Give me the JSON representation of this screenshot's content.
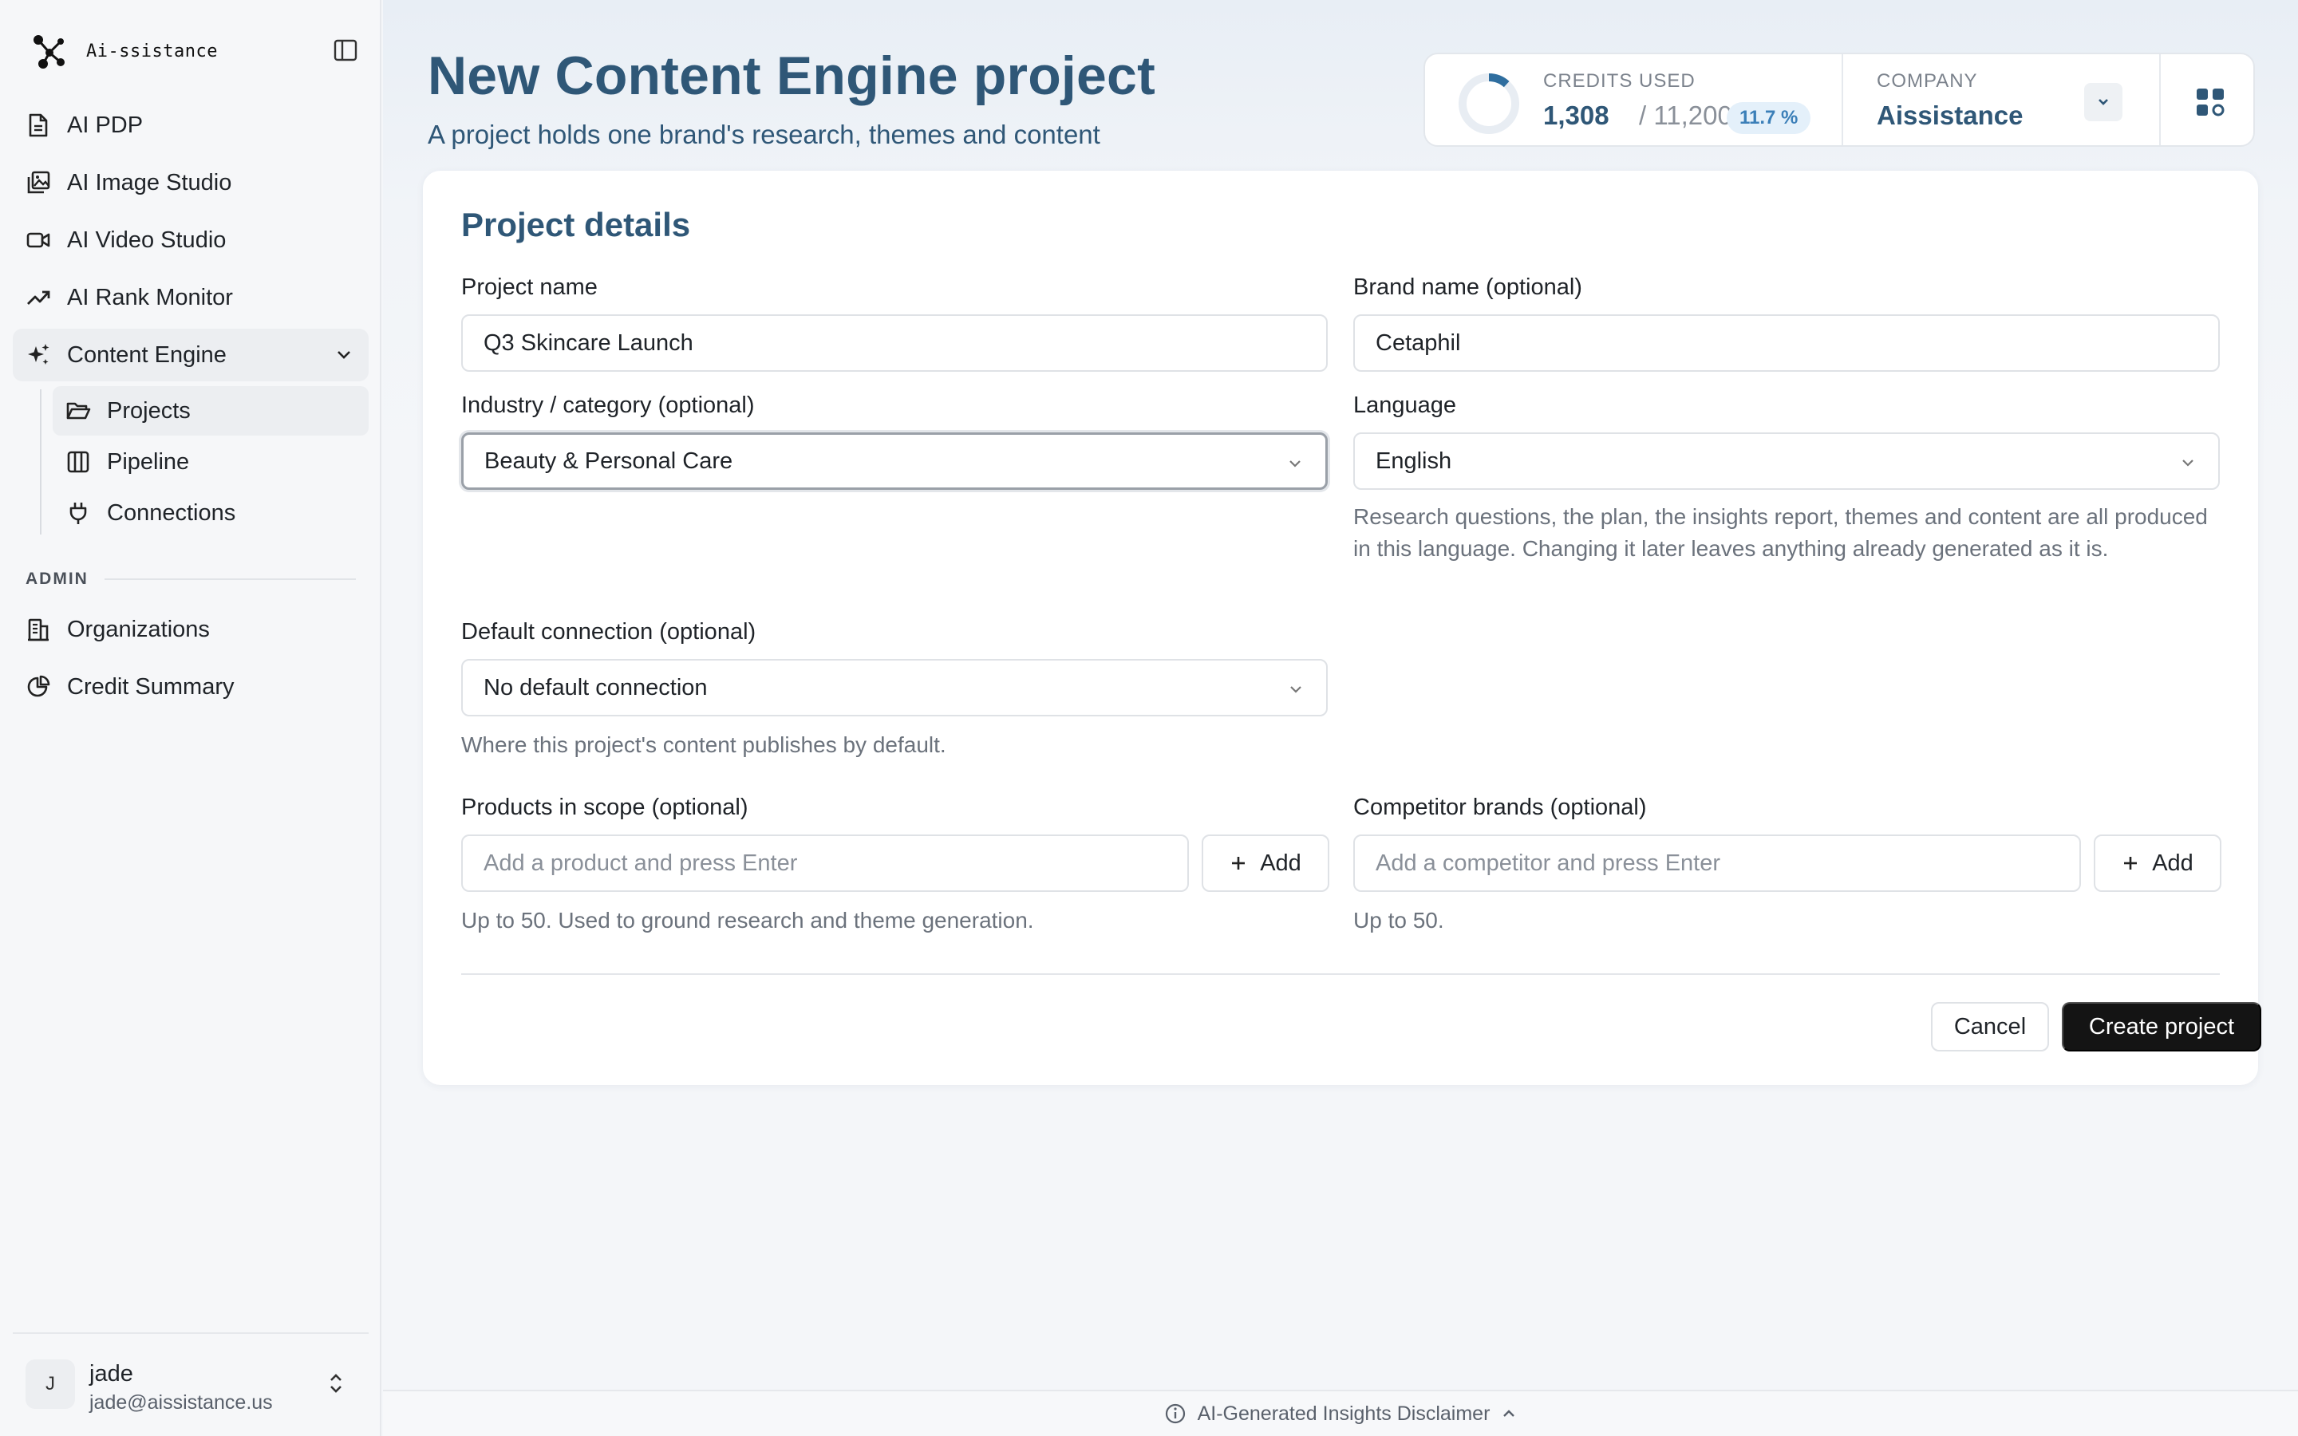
{
  "app": {
    "name": "Ai-ssistance"
  },
  "sidebar": {
    "items": [
      {
        "label": "AI PDP",
        "icon": "document-icon"
      },
      {
        "label": "AI Image Studio",
        "icon": "image-gallery-icon"
      },
      {
        "label": "AI Video Studio",
        "icon": "video-icon"
      },
      {
        "label": "AI Rank Monitor",
        "icon": "trending-up-icon"
      },
      {
        "label": "Content Engine",
        "icon": "sparkles-icon"
      }
    ],
    "sub_items": [
      {
        "label": "Projects",
        "icon": "folder-open-icon"
      },
      {
        "label": "Pipeline",
        "icon": "columns-icon"
      },
      {
        "label": "Connections",
        "icon": "plug-icon"
      }
    ],
    "admin_label": "ADMIN",
    "admin_items": [
      {
        "label": "Organizations",
        "icon": "building-icon"
      },
      {
        "label": "Credit Summary",
        "icon": "pie-chart-icon"
      }
    ]
  },
  "user": {
    "initial": "J",
    "name": "jade",
    "email": "jade@aissistance.us"
  },
  "header": {
    "title": "New Content Engine project",
    "subtitle": "A project holds one brand's research, themes and content"
  },
  "credits": {
    "label": "CREDITS USED",
    "used": "1,308",
    "total": "/ 11,200",
    "percent_label": "11.7 %",
    "fraction": 0.117,
    "accent": "#2f6e9f"
  },
  "company": {
    "label": "COMPANY",
    "name": "Aissistance"
  },
  "form": {
    "section_title": "Project details",
    "project_name": {
      "label": "Project name",
      "value": "Q3 Skincare Launch"
    },
    "brand_name": {
      "label": "Brand name (optional)",
      "value": "Cetaphil"
    },
    "industry": {
      "label": "Industry / category (optional)",
      "value": "Beauty & Personal Care"
    },
    "language": {
      "label": "Language",
      "value": "English",
      "help": "Research questions, the plan, the insights report, themes and content are all produced in this language. Changing it later leaves anything already generated as it is."
    },
    "default_connection": {
      "label": "Default connection (optional)",
      "value": "No default connection",
      "help": "Where this project's content publishes by default."
    },
    "products": {
      "label": "Products in scope (optional)",
      "placeholder": "Add a product and press Enter",
      "add_label": "Add",
      "help": "Up to 50. Used to ground research and theme generation."
    },
    "competitors": {
      "label": "Competitor brands (optional)",
      "placeholder": "Add a competitor and press Enter",
      "add_label": "Add",
      "help": "Up to 50."
    },
    "cancel_label": "Cancel",
    "create_label": "Create project"
  },
  "footer": {
    "disclaimer": "AI-Generated Insights Disclaimer"
  }
}
